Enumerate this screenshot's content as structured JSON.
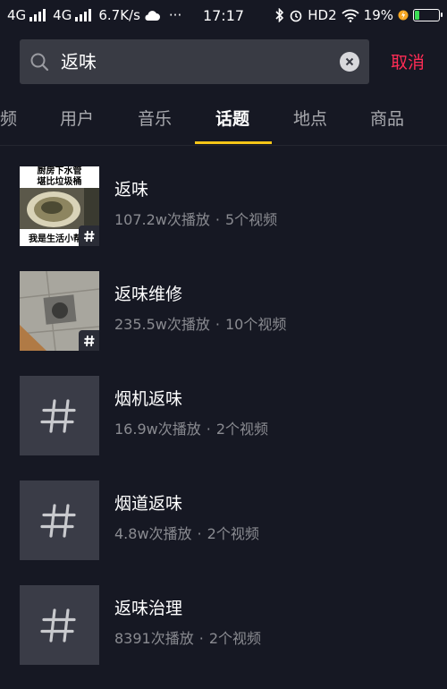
{
  "status_bar": {
    "network1": "4G",
    "network2": "4G",
    "speed": "6.7K/s",
    "more": "···",
    "time": "17:17",
    "hd": "HD2",
    "battery_percent": "19%",
    "battery_level": 0.19
  },
  "search": {
    "query": "返味",
    "cancel_label": "取消"
  },
  "tabs": [
    {
      "label": "频"
    },
    {
      "label": "用户"
    },
    {
      "label": "音乐"
    },
    {
      "label": "话题"
    },
    {
      "label": "地点"
    },
    {
      "label": "商品"
    }
  ],
  "results": [
    {
      "title": "返味",
      "plays": "107.2w次播放",
      "videos": "5个视频",
      "thumb_caption_top": "厨房下水管\n堪比垃圾桶",
      "thumb_caption_bottom": "我是生活小帮"
    },
    {
      "title": "返味维修",
      "plays": "235.5w次播放",
      "videos": "10个视频"
    },
    {
      "title": "烟机返味",
      "plays": "16.9w次播放",
      "videos": "2个视频"
    },
    {
      "title": "烟道返味",
      "plays": "4.8w次播放",
      "videos": "2个视频"
    },
    {
      "title": "返味治理",
      "plays": "8391次播放",
      "videos": "2个视频"
    }
  ],
  "colors": {
    "background": "#161823",
    "accent_cancel": "#fe2c55",
    "tab_indicator": "#f5c518",
    "battery_fill": "#3ddc55"
  }
}
